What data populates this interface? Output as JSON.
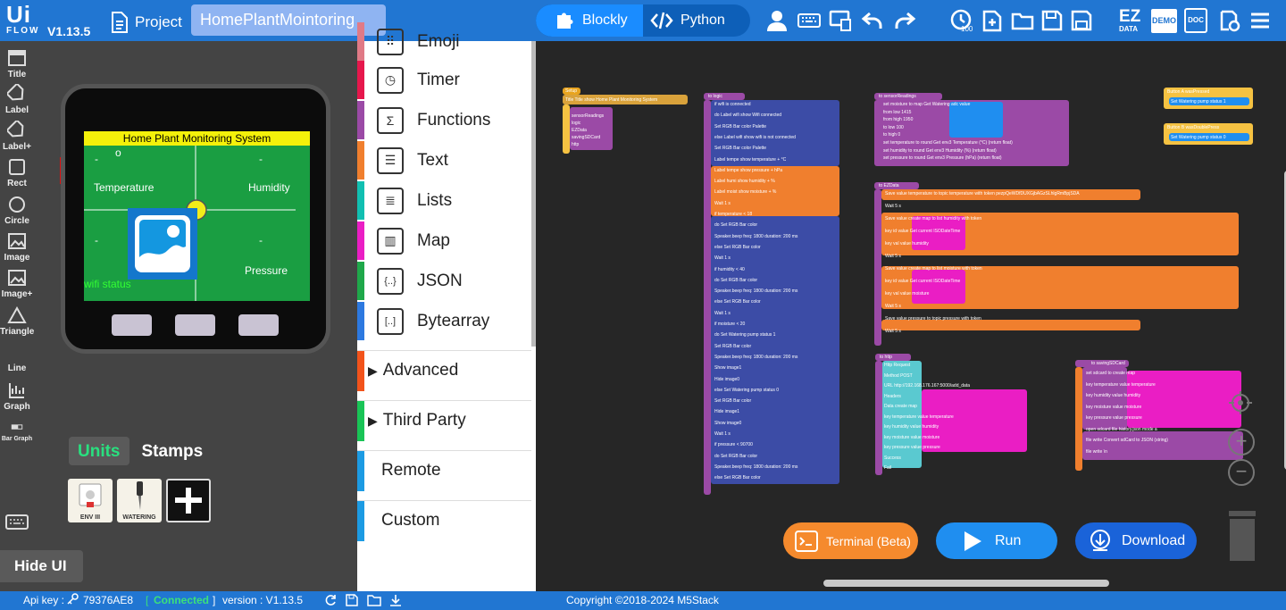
{
  "header": {
    "logo_top": "Ui",
    "logo_bottom": "FLOW",
    "version": "V1.13.5",
    "project_label": "Project",
    "project_name": "HomePlantMointoring",
    "mode_blockly": "Blockly",
    "mode_python": "Python",
    "ez_data_top": "EZ",
    "ez_data_bottom": "DATA",
    "demo_label": "DEMO",
    "doc_label": "DOC",
    "icons": [
      "user-icon",
      "keyboard-icon",
      "device-screen-icon",
      "undo-icon",
      "redo-icon",
      "timer-100-icon",
      "new-file-icon",
      "open-folder-icon",
      "save-icon",
      "save-as-icon",
      "ez-data-icon",
      "demo-icon",
      "doc-icon",
      "settings-icon",
      "menu-icon"
    ]
  },
  "tools": [
    {
      "label": "Title",
      "icon": "title-icon"
    },
    {
      "label": "Label",
      "icon": "label-icon"
    },
    {
      "label": "Label+",
      "icon": "label-plus-icon"
    },
    {
      "label": "Rect",
      "icon": "rect-icon"
    },
    {
      "label": "Circle",
      "icon": "circle-icon"
    },
    {
      "label": "Image",
      "icon": "image-icon"
    },
    {
      "label": "Image+",
      "icon": "image-plus-icon"
    },
    {
      "label": "Triangle",
      "icon": "triangle-icon"
    },
    {
      "label": "Line",
      "icon": "line-icon"
    },
    {
      "label": "Graph",
      "icon": "graph-icon"
    },
    {
      "label": "Bar Graph",
      "icon": "bar-graph-icon"
    }
  ],
  "device": {
    "screen_title": "Home Plant Monitoring System",
    "o_label": "o",
    "dash": "-",
    "temperature": "Temperature",
    "humidity": "Humidity",
    "pressure": "Pressure",
    "wifi_status": "wifi status"
  },
  "units_panel": {
    "tab_units": "Units",
    "tab_stamps": "Stamps",
    "units": [
      {
        "label": "ENV III",
        "icon": "env3-sensor-icon"
      },
      {
        "label": "WATERING",
        "icon": "watering-unit-icon"
      }
    ],
    "add_icon": "plus-icon",
    "hide_ui": "Hide UI"
  },
  "palette": {
    "categories": [
      {
        "label": "Emoji",
        "color": "#e07a86",
        "icon": "emoji-icon",
        "glyph": "⠿"
      },
      {
        "label": "Timer",
        "color": "#e6174c",
        "icon": "timer-icon",
        "glyph": "◷"
      },
      {
        "label": "Functions",
        "color": "#9b4aa6",
        "icon": "functions-icon",
        "glyph": "Σ"
      },
      {
        "label": "Text",
        "color": "#f07f2e",
        "icon": "text-icon",
        "glyph": "☰"
      },
      {
        "label": "Lists",
        "color": "#11bfb1",
        "icon": "lists-icon",
        "glyph": "≣"
      },
      {
        "label": "Map",
        "color": "#ea1ec4",
        "icon": "map-icon",
        "glyph": "▥"
      },
      {
        "label": "JSON",
        "color": "#1fa84a",
        "icon": "json-icon",
        "glyph": "{..}"
      },
      {
        "label": "Bytearray",
        "color": "#2d79e0",
        "icon": "bytearray-icon",
        "glyph": "[..]"
      }
    ],
    "groups": [
      {
        "label": "Advanced",
        "color": "#f2531b",
        "arrow": "▶"
      },
      {
        "label": "Third Party",
        "color": "#19c456",
        "arrow": "▶"
      },
      {
        "label": "Remote",
        "color": "#1c9be3",
        "arrow": ""
      },
      {
        "label": "Custom",
        "color": "#1c9be3",
        "arrow": ""
      }
    ]
  },
  "workspace": {
    "blocks": {
      "setup_header": "Setup",
      "setup_title": "Title Title show Home Plant Monitoring System",
      "setup_items": [
        "sensorReadings",
        "logic",
        "EZData",
        "savingSDCard",
        "http"
      ],
      "logic_header": "to logic",
      "logic_lines": [
        "if wifi is connected",
        "do Label wifi show Wifi connected",
        "Set RGB Bar color Palette",
        "else Label wifi show wifi is not connected",
        "Set RGB Bar color Palette",
        "Label tempe show temperature + °C",
        "Label tempe show pressure + hPa",
        "Label humi show humidity + %",
        "Label moist show moisture + %",
        "Wait 1 s",
        "if temperature < 18",
        "do Set RGB Bar color",
        "Speaker.beep freq: 1800 duration: 200 ms",
        "else Set RGB Bar color",
        "Wait 1 s",
        "if humidity < 40",
        "do Set RGB Bar color",
        "Speaker.beep freq: 1800 duration: 200 ms",
        "else Set RGB Bar color",
        "Wait 1 s",
        "if moisture < 20",
        "do Set Watering pump status 1",
        "Set RGB Bar color",
        "Speaker.beep freq: 1800 duration: 200 ms",
        "Show image1",
        "Hide image0",
        "else Set Watering pump status 0",
        "Set RGB Bar color",
        "Hide image1",
        "Show image0",
        "Wait 1 s",
        "if pressure < 90700",
        "do Set RGB Bar color",
        "Speaker.beep freq: 1800 duration: 200 ms",
        "else Set RGB Bar color"
      ],
      "sensor_header": "to sensorReadings",
      "sensor_lines": [
        "set moisture to map Get Watering adc value",
        "from low 1415",
        "from high 1950",
        "to low 100",
        "to high 0",
        "set temperature to round Get env3 Temperature (°C) (return float)",
        "set humidity to round Get env3 Humidity (%) (return float)",
        "set pressure to round Get env3 Pressure (hPa) (return float)"
      ],
      "ez_header": "to EZData",
      "ez_lines": [
        "Save value temperature to topic temperature with token pezpQeWDfDUXGjbAGzSLhlgRmBpjSDA",
        "Wait 5 s",
        "Save value create map to list humidity with token",
        "key id value Get current ISODateTime",
        "key val value humidity",
        "Wait 5 s",
        "Save value create map to list moisture with token",
        "key id value Get current ISODateTime",
        "key val value moisture",
        "Wait 5 s",
        "Save value pressure to topic pressure with token",
        "Wait 5 s"
      ],
      "http_header": "to http",
      "http_lines": [
        "Http Request",
        "Method POST",
        "URL http://192.168.176.167:5000/add_data",
        "Headers",
        "Data create map",
        "key temperature value temperature",
        "key humidity value humidity",
        "key moisture value moisture",
        "key pressure value pressure",
        "Success",
        "Fail"
      ],
      "sd_header": "to savingSDCard",
      "sd_lines": [
        "set sdcard to create map",
        "key temperature value temperature",
        "key humidity value humidity",
        "key moisture value moisture",
        "key pressure value pressure",
        "open sdcard file history.json mode a",
        "file write Convert sdCard to JSON (string)",
        "file write \\n"
      ],
      "button_a": "Button A wasPressed",
      "button_a_do": "Set Watering pump status 1",
      "button_b": "Button B wasDoublePress",
      "button_b_do": "Set Watering pump status 0"
    },
    "actions": {
      "terminal": "Terminal (Beta)",
      "run": "Run",
      "download": "Download"
    },
    "colors": {
      "terminal": "#f58a2d",
      "run": "#1f8ef0",
      "download": "#1a63d9"
    }
  },
  "statusbar": {
    "api_key_label": "Api key :",
    "api_key": "79376AE8",
    "conn_open": "[",
    "connected": "Connected",
    "conn_close": "]",
    "version_label": "version : V1.13.5",
    "copyright": "Copyright ©2018-2024 M5Stack"
  }
}
